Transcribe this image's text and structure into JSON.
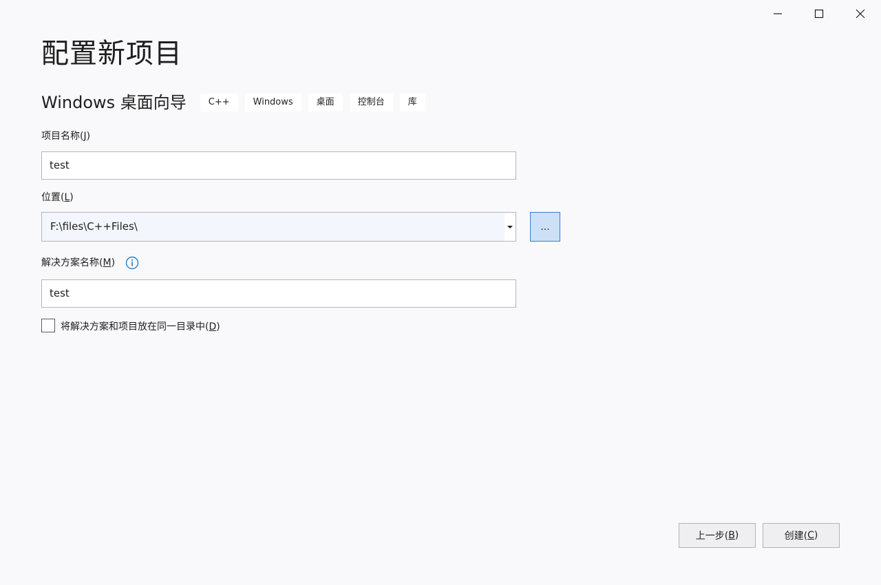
{
  "window": {
    "controls": [
      "minimize-icon",
      "maximize-icon",
      "close-icon"
    ]
  },
  "page": {
    "title": "配置新项目"
  },
  "template": {
    "name": "Windows 桌面向导",
    "tags": [
      "C++",
      "Windows",
      "桌面",
      "控制台",
      "库"
    ]
  },
  "project_name": {
    "label": "项目名称(",
    "mnemonic": "J",
    "label_end": ")",
    "value": "test"
  },
  "location": {
    "label": "位置(",
    "mnemonic": "L",
    "label_end": ")",
    "value": "F:\\files\\C++Files\\",
    "browse_label": "..."
  },
  "solution_name": {
    "label": "解决方案名称(",
    "mnemonic": "M",
    "label_end": ")",
    "value": "test",
    "info_icon": "info-icon"
  },
  "same_directory": {
    "label": "将解决方案和项目放在同一目录中(",
    "mnemonic": "D",
    "label_end": ")",
    "checked": false
  },
  "footer": {
    "back_label": "上一步(",
    "back_mnemonic": "B",
    "back_end": ")",
    "create_label": "创建(",
    "create_mnemonic": "C",
    "create_end": ")"
  },
  "colors": {
    "background": "#f9f9fb",
    "accent": "#3878d6",
    "info": "#1e80d0"
  }
}
